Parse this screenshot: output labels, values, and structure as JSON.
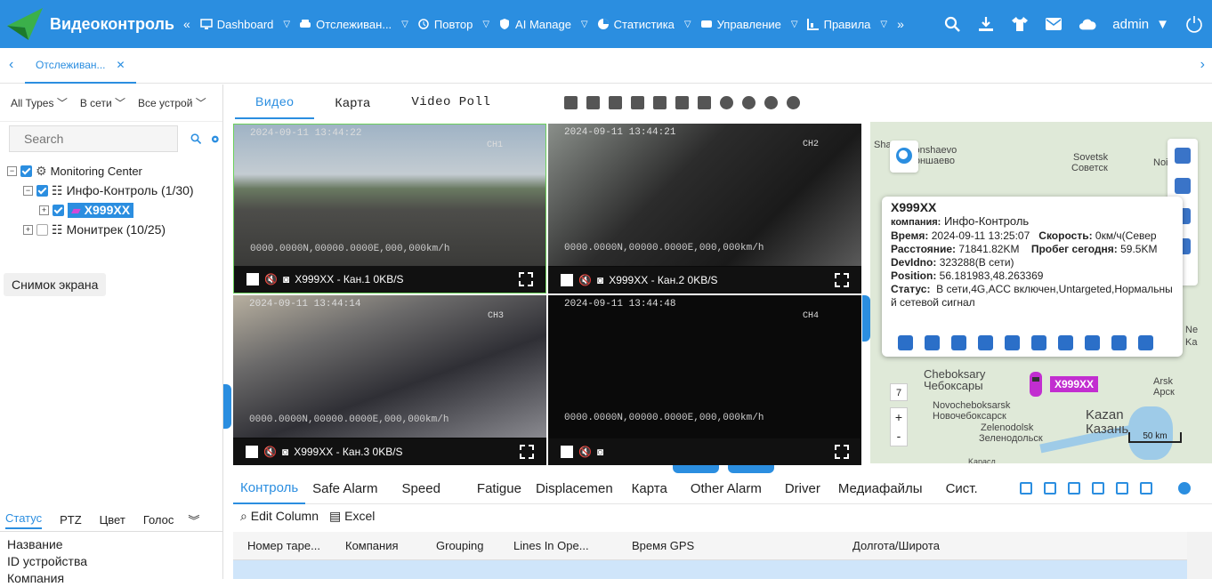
{
  "header": {
    "app_title": "Видеоконтроль",
    "nav": [
      {
        "label": "Dashboard",
        "icon": "dashboard-icon"
      },
      {
        "label": "Отслеживан...",
        "icon": "car-icon"
      },
      {
        "label": "Повтор",
        "icon": "replay-icon"
      },
      {
        "label": "AI Manage",
        "icon": "shield-icon"
      },
      {
        "label": "Статистика",
        "icon": "pie-chart-icon"
      },
      {
        "label": "Управление",
        "icon": "bus-icon"
      },
      {
        "label": "Правила",
        "icon": "rules-icon"
      }
    ],
    "user": "admin"
  },
  "tabs": {
    "active": "Отслеживан..."
  },
  "left": {
    "filters": [
      "All Types",
      "В сети",
      "Все устрой"
    ],
    "search_placeholder": "Search",
    "tree": {
      "root": "Monitoring Center",
      "group1": "Инфо-Контроль (1/30)",
      "vehicle": "X999XX",
      "group2": "Монитрек (10/25)"
    },
    "snapshot_tooltip": "Снимок экрана",
    "bottom_tabs": [
      "Статус",
      "PTZ",
      "Цвет",
      "Голос"
    ],
    "props": [
      "Название",
      "ID устройства",
      "Компания"
    ]
  },
  "video_tabs": [
    "Видео",
    "Карта",
    "Video Poll"
  ],
  "videos": [
    {
      "timestamp": "2024-09-11 13:44:22",
      "channel": "CH1",
      "coord": "0000.0000N,00000.0000E,000,000km/h",
      "label": "X999XX - Кан.1 0KB/S"
    },
    {
      "timestamp": "2024-09-11 13:44:21",
      "channel": "CH2",
      "coord": "0000.0000N,00000.0000E,000,000km/h",
      "label": "X999XX - Кан.2 0KB/S"
    },
    {
      "timestamp": "2024-09-11 13:44:14",
      "channel": "CH3",
      "coord": "0000.0000N,00000.0000E,000,000km/h",
      "label": "X999XX - Кан.3 0KB/S"
    },
    {
      "timestamp": "2024-09-11 13:44:48",
      "channel": "CH4",
      "coord": "0000.0000N,00000.0000E,000,000km/h",
      "label": ""
    }
  ],
  "popup": {
    "title": "X999XX",
    "company_label": "компания:",
    "company": "Инфо-Контроль",
    "time_label": "Время:",
    "time": "2024-09-11 13:25:07",
    "speed_label": "Скорость:",
    "speed": "0км/ч(Север",
    "distance_label": "Расстояние:",
    "distance": "71841.82KM",
    "today_label": "Пробег сегодня:",
    "today": "59.5KM",
    "devid_label": "DevIdno:",
    "devid": "323288(В сети)",
    "position_label": "Position:",
    "position": "56.181983,48.263369",
    "status_label": "Статус:",
    "status": "В сети,4G,ACC включен,Untargeted,Нормальны",
    "status2": "й сетевой сигнал"
  },
  "map": {
    "labels": [
      "Tonshaevo",
      "Тоншаево",
      "Sovetsk",
      "Советск",
      "Cheboksary",
      "Чебоксары",
      "Novocheboksarsk",
      "Новочебоксарск",
      "Zelenodolsk",
      "Зеленодольск",
      "Kazan",
      "Казань",
      "Arsk",
      "Арск",
      "Sha",
      "Noi",
      "Ne",
      "Ka",
      "Kaраcл"
    ],
    "marker": "X999XX",
    "zoom_level": "7",
    "scale": "50 km"
  },
  "bottom_tabs": [
    "Контроль",
    "Safe Alarm",
    "Speed",
    "Fatigue",
    "Displacemen",
    "Карта",
    "Other Alarm",
    "Driver",
    "Медиафайлы",
    "Сист."
  ],
  "toolbar": {
    "edit_column": "Edit Column",
    "excel": "Excel"
  },
  "table_headers": [
    "Номер таре...",
    "Компания",
    "Grouping",
    "Lines In Ope...",
    "Время GPS",
    "Долгота/Широта"
  ]
}
